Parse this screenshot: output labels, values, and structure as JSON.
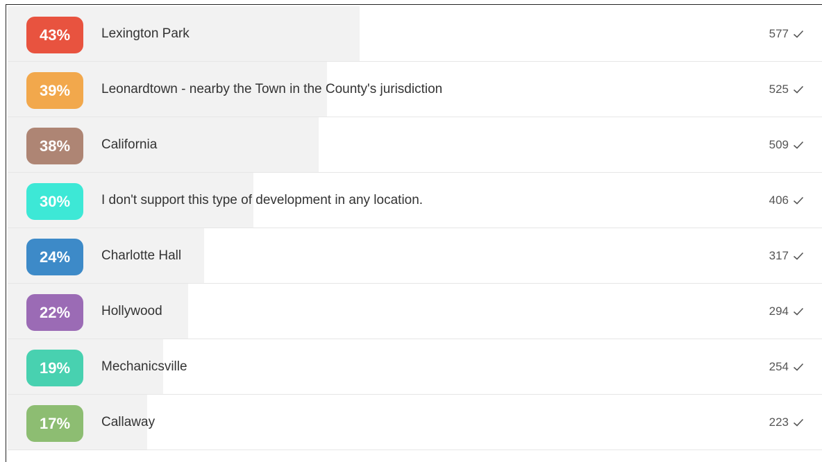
{
  "results": [
    {
      "percent_label": "43%",
      "percent": 43,
      "label": "Lexington Park",
      "count": "577",
      "color": "#e8533f"
    },
    {
      "percent_label": "39%",
      "percent": 39,
      "label": "Leonardtown - nearby the Town in the County's jurisdiction",
      "count": "525",
      "color": "#f2a84c"
    },
    {
      "percent_label": "38%",
      "percent": 38,
      "label": "California",
      "count": "509",
      "color": "#ae8574"
    },
    {
      "percent_label": "30%",
      "percent": 30,
      "label": "I don't support this type of development in any location.",
      "count": "406",
      "color": "#3de8d6"
    },
    {
      "percent_label": "24%",
      "percent": 24,
      "label": "Charlotte Hall",
      "count": "317",
      "color": "#3d8ac8"
    },
    {
      "percent_label": "22%",
      "percent": 22,
      "label": "Hollywood",
      "count": "294",
      "color": "#9b6bb5"
    },
    {
      "percent_label": "19%",
      "percent": 19,
      "label": "Mechanicsville",
      "count": "254",
      "color": "#48d1b0"
    },
    {
      "percent_label": "17%",
      "percent": 17,
      "label": "Callaway",
      "count": "223",
      "color": "#8dbd72"
    }
  ],
  "icons": {
    "count_icon": "checkmark-icon"
  }
}
